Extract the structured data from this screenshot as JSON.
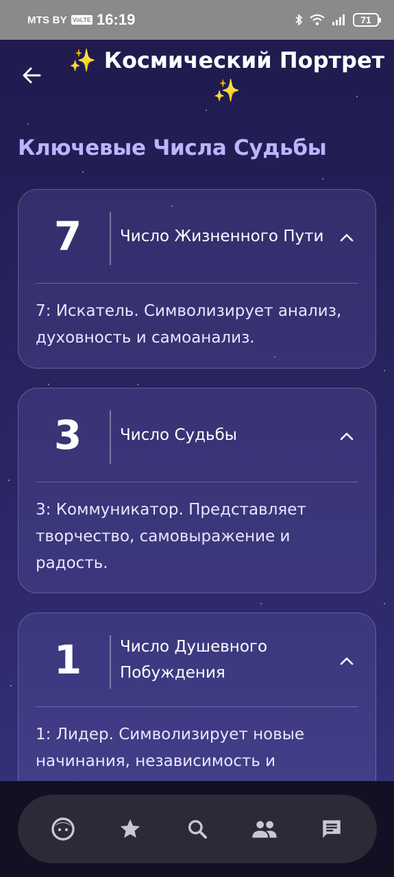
{
  "status_bar": {
    "carrier": "MTS BY",
    "volte": "VoLTE",
    "time": "16:19",
    "battery": "71",
    "icons": [
      "bluetooth-icon",
      "wifi-icon",
      "signal-icon",
      "battery-icon"
    ]
  },
  "header": {
    "title": "Космический Портрет",
    "sparkle_left": "✨",
    "sparkle_right": "✨",
    "back_icon": "arrow-left-icon"
  },
  "section_heading": "Ключевые Числа Судьбы",
  "cards": [
    {
      "number": "7",
      "label": "Число Жизненного Пути",
      "description": "7: Искатель. Символизирует анализ, духовность и самоанализ.",
      "expanded": true
    },
    {
      "number": "3",
      "label": "Число Судьбы",
      "description": "3: Коммуникатор. Представляет творчество, самовыражение и радость.",
      "expanded": true
    },
    {
      "number": "1",
      "label": "Число Душевного Побуждения",
      "description": "1: Лидер. Символизирует новые начинания, независимость и",
      "expanded": true
    }
  ],
  "bottom_nav": [
    "face-icon",
    "star-icon",
    "search-icon",
    "people-icon",
    "chat-icon"
  ],
  "colors": {
    "background_top": "#1e1a4c",
    "background_bottom": "#393580",
    "heading": "#b9b6ff",
    "sparkle": "#ffd54a",
    "nav_bar": "#2b2a36"
  }
}
